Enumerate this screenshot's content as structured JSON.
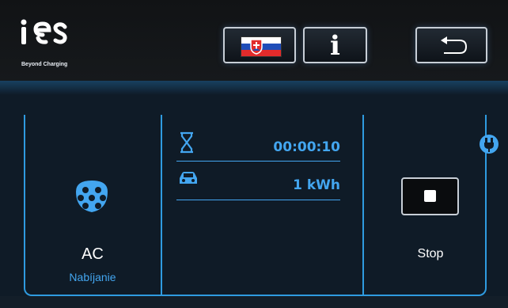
{
  "header": {
    "logo_text": "ies",
    "tagline": "Beyond Charging",
    "language_flag": "flag-slovakia-icon",
    "info_label": "i",
    "back_icon": "back-arrow-icon"
  },
  "session": {
    "connector_type": "AC",
    "status": "Nabíjanie",
    "duration_icon": "hourglass-icon",
    "duration": "00:00:10",
    "energy_icon": "car-icon",
    "energy": "1 kWh",
    "connector_icon": "type2-connector-icon"
  },
  "controls": {
    "stop_label": "Stop",
    "stop_icon": "stop-square-icon",
    "plug_icon": "plug-icon"
  },
  "colors": {
    "accent": "#43a6f0",
    "border": "#2f9be0",
    "background": "#0f1b27",
    "header": "#131619"
  }
}
